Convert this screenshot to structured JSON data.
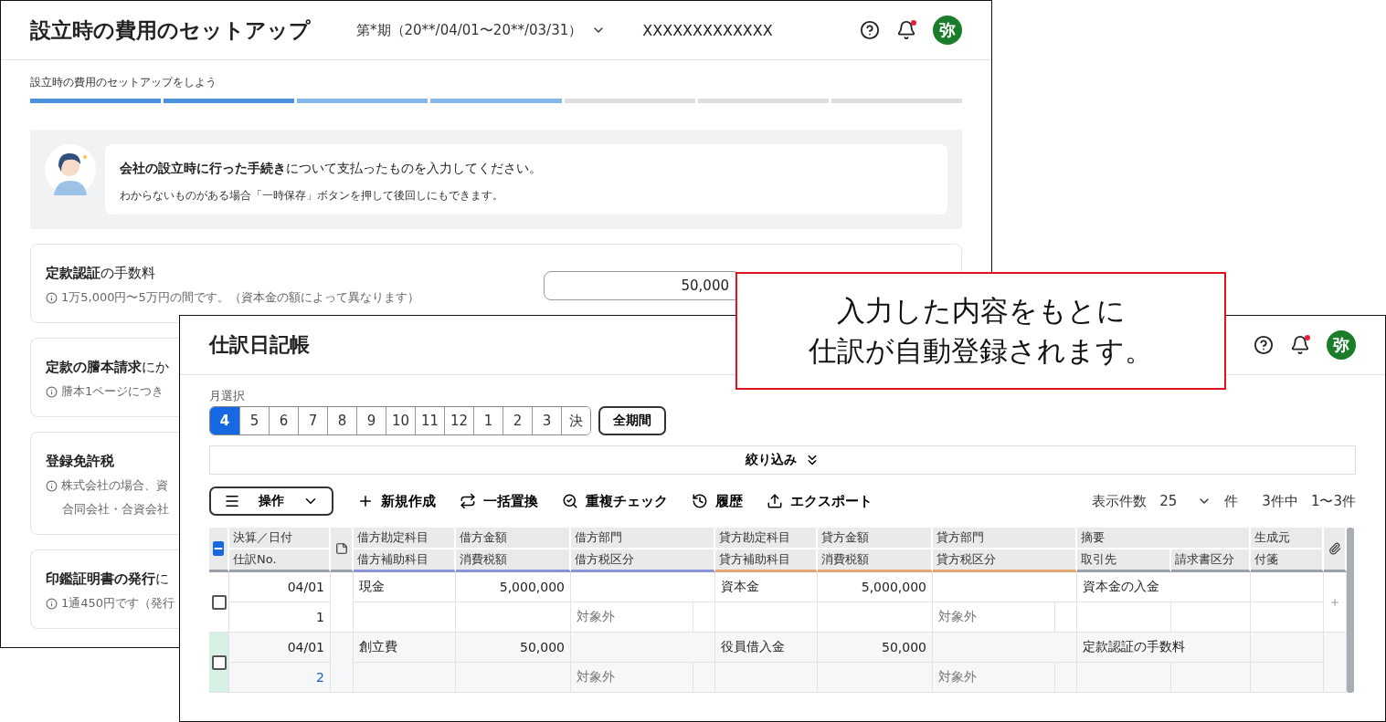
{
  "back_window": {
    "title": "設立時の費用のセットアップ",
    "period": "第*期（20**/04/01〜20**/03/31）",
    "company": "XXXXXXXXXXXXX",
    "notification_unread": true,
    "avatar": "弥",
    "step_label": "設立時の費用のセットアップをしよう",
    "steps": [
      {
        "color": "#4a8fe0"
      },
      {
        "color": "#4a8fe0"
      },
      {
        "color": "#86b6ec"
      },
      {
        "color": "#86b6ec"
      },
      {
        "color": "#dcdde0"
      },
      {
        "color": "#dcdde0"
      },
      {
        "color": "#dcdde0"
      }
    ],
    "guide": {
      "message": "**会社の設立時に行った手続き**について支払ったものを入力してください。",
      "note": "わからないものがある場合「一時保存」ボタンを押して後回しにもできます。"
    },
    "items": [
      {
        "title": "**定款認証**の手数料",
        "hints": [
          "1万5,000円〜5万円の間です。（資本金の額によって異なります）"
        ],
        "value": "50,000"
      },
      {
        "title": "**定款の謄本請求**にか",
        "hints": [
          "謄本1ページにつき"
        ]
      },
      {
        "title": "**登録免許税**",
        "hints": [
          "株式会社の場合、資",
          "合同会社・合資会社"
        ]
      },
      {
        "title": "**印鑑証明書の発行**に",
        "hints": [
          "1通450円です（発行"
        ]
      }
    ]
  },
  "front_window": {
    "title": "仕訳日記帳",
    "notification_unread": true,
    "avatar": "弥",
    "month_label": "月選択",
    "months": [
      {
        "label": "4",
        "selected": true
      },
      {
        "label": "5",
        "selected": false
      },
      {
        "label": "6",
        "selected": false
      },
      {
        "label": "7",
        "selected": false
      },
      {
        "label": "8",
        "selected": false
      },
      {
        "label": "9",
        "selected": false
      },
      {
        "label": "10",
        "selected": false
      },
      {
        "label": "11",
        "selected": false
      },
      {
        "label": "12",
        "selected": false
      },
      {
        "label": "1",
        "selected": false
      },
      {
        "label": "2",
        "selected": false
      },
      {
        "label": "3",
        "selected": false
      },
      {
        "label": "決",
        "selected": false
      }
    ],
    "all_period": "全期間",
    "filter": "絞り込み",
    "operation": "操作",
    "actions": [
      {
        "kind": "new",
        "label": "新規作成"
      },
      {
        "kind": "replace",
        "label": "一括置換"
      },
      {
        "kind": "duplicate",
        "label": "重複チェック"
      },
      {
        "kind": "history",
        "label": "履歴"
      },
      {
        "kind": "export",
        "label": "エクスポート"
      }
    ],
    "page_size_label": "表示件数",
    "page_size": "25",
    "page_size_unit": "件",
    "total": "3件中",
    "range": "1〜3件",
    "table": {
      "select_all_indeterminate": true,
      "header_top": [
        "決算／日付",
        "借方勘定科目",
        "借方金額",
        "借方部門",
        "貸方勘定科目",
        "貸方金額",
        "貸方部門",
        "摘要",
        "生成元"
      ],
      "header_bottom": [
        "仕訳No.",
        "借方補助科目",
        "消費税額",
        "借方税区分",
        "貸方補助科目",
        "消費税額",
        "貸方税区分",
        "取引先",
        "請求書区分",
        "付箋"
      ],
      "entries": [
        {
          "checked": false,
          "highlighted": false,
          "attach_button": true,
          "date": "04/01",
          "no": "1",
          "debit_account": "現金",
          "debit_amount": "5,000,000",
          "debit_tax_class": "対象外",
          "credit_account": "資本金",
          "credit_amount": "5,000,000",
          "credit_tax_class": "対象外",
          "summary": "資本金の入金"
        },
        {
          "checked": false,
          "highlighted": true,
          "attach_button": false,
          "date": "04/01",
          "no": "2",
          "debit_account": "創立費",
          "debit_amount": "50,000",
          "debit_tax_class": "対象外",
          "credit_account": "役員借入金",
          "credit_amount": "50,000",
          "credit_tax_class": "対象外",
          "summary": "定款認証の手数料"
        }
      ]
    }
  },
  "callout": {
    "lines": [
      "入力した内容をもとに",
      "仕訳が自動登録されます。"
    ]
  }
}
